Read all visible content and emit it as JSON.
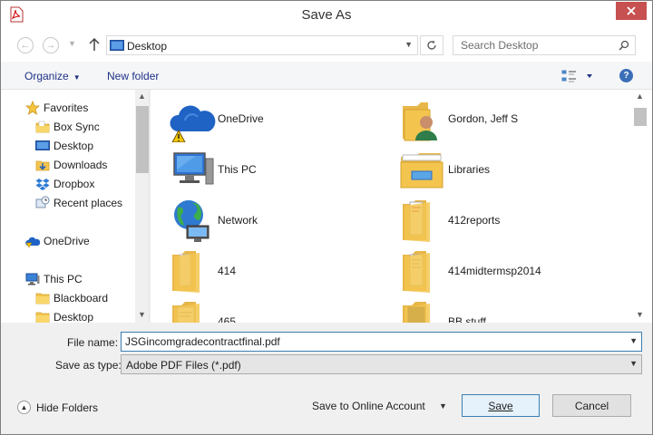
{
  "window": {
    "title": "Save As",
    "app_icon": "pdf-file-icon"
  },
  "address_bar": {
    "location": "Desktop",
    "location_icon": "desktop-icon",
    "search_placeholder": "Search Desktop"
  },
  "toolbar": {
    "organize_label": "Organize",
    "new_folder_label": "New folder",
    "help_label": "?"
  },
  "nav_pane": {
    "items": [
      {
        "label": "Favorites",
        "icon": "star-icon",
        "indent": 0
      },
      {
        "label": "Box Sync",
        "icon": "folder-icon",
        "indent": 1
      },
      {
        "label": "Desktop",
        "icon": "desktop-icon",
        "indent": 1
      },
      {
        "label": "Downloads",
        "icon": "downloads-icon",
        "indent": 1
      },
      {
        "label": "Dropbox",
        "icon": "dropbox-icon",
        "indent": 1
      },
      {
        "label": "Recent places",
        "icon": "recent-places-icon",
        "indent": 1
      },
      {
        "label": "OneDrive",
        "icon": "onedrive-icon",
        "indent": 0
      },
      {
        "label": "This PC",
        "icon": "computer-icon",
        "indent": 0
      },
      {
        "label": "Blackboard",
        "icon": "folder-icon",
        "indent": 1
      },
      {
        "label": "Desktop",
        "icon": "desktop-icon",
        "indent": 1
      }
    ]
  },
  "content": {
    "items": [
      {
        "label": "OneDrive",
        "icon": "onedrive-warning-icon"
      },
      {
        "label": "Gordon, Jeff S",
        "icon": "user-folder-icon"
      },
      {
        "label": "This PC",
        "icon": "computer-icon"
      },
      {
        "label": "Libraries",
        "icon": "libraries-icon"
      },
      {
        "label": "Network",
        "icon": "network-globe-icon"
      },
      {
        "label": "412reports",
        "icon": "folder-icon"
      },
      {
        "label": "414",
        "icon": "folder-icon"
      },
      {
        "label": "414midtermsp2014",
        "icon": "folder-icon"
      },
      {
        "label": "465",
        "icon": "folder-icon"
      },
      {
        "label": "BB stuff",
        "icon": "folder-icon"
      }
    ]
  },
  "fields": {
    "file_name_label": "File name:",
    "file_name_value": "JSGincomgradecontractfinal.pdf",
    "save_type_label": "Save as type:",
    "save_type_value": "Adobe PDF Files (*.pdf)"
  },
  "footer": {
    "hide_folders_label": "Hide Folders",
    "online_label": "Save to Online Account",
    "save_label": "Save",
    "cancel_label": "Cancel"
  },
  "colors": {
    "accent_blue": "#1e3287",
    "focus_border": "#3c7fb1",
    "close_red": "#c75050",
    "folder_yellow": "#f3c54f"
  }
}
